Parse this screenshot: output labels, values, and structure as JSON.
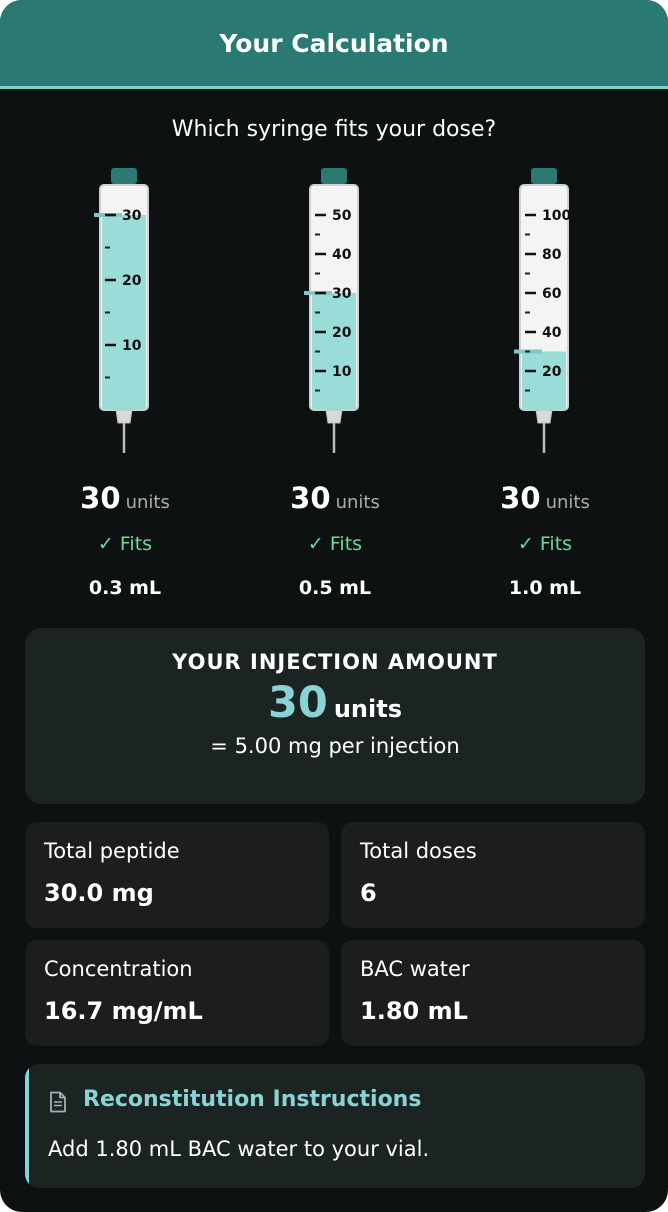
{
  "header": {
    "title": "Your Calculation"
  },
  "question": "Which syringe fits your dose?",
  "syringes": [
    {
      "capacity": "0.3 mL",
      "max_units": 30,
      "fill_units": 30,
      "labels": [
        "30",
        "20",
        "10"
      ],
      "label_values": [
        30,
        20,
        10
      ],
      "minor_ticks": [
        25,
        15,
        5
      ],
      "dose_value": "30",
      "dose_unit": "units",
      "status": "✓ Fits"
    },
    {
      "capacity": "0.5 mL",
      "max_units": 50,
      "fill_units": 30,
      "labels": [
        "50",
        "40",
        "30",
        "20",
        "10"
      ],
      "label_values": [
        50,
        40,
        30,
        20,
        10
      ],
      "minor_ticks": [
        45,
        35,
        25,
        15,
        5
      ],
      "dose_value": "30",
      "dose_unit": "units",
      "status": "✓ Fits"
    },
    {
      "capacity": "1.0 mL",
      "max_units": 100,
      "fill_units": 30,
      "labels": [
        "100",
        "80",
        "60",
        "40",
        "20"
      ],
      "label_values": [
        100,
        80,
        60,
        40,
        20
      ],
      "minor_ticks": [
        90,
        70,
        50,
        30,
        10
      ],
      "dose_value": "30",
      "dose_unit": "units",
      "status": "✓ Fits"
    }
  ],
  "injection": {
    "title": "YOUR INJECTION AMOUNT",
    "value": "30",
    "unit": "units",
    "subtitle": "= 5.00 mg per injection"
  },
  "stats": [
    {
      "label": "Total peptide",
      "value": "30.0 mg"
    },
    {
      "label": "Total doses",
      "value": "6"
    },
    {
      "label": "Concentration",
      "value": "16.7 mg/mL"
    },
    {
      "label": "BAC water",
      "value": "1.80 mL"
    }
  ],
  "reconstitution": {
    "icon": "document-icon",
    "title": "Reconstitution Instructions",
    "text": "Add 1.80 mL BAC water to your vial."
  },
  "colors": {
    "accent": "#2a7a73",
    "fill": "#99dcd8",
    "fits": "#6ddc9a",
    "highlight": "#89d3d5"
  }
}
